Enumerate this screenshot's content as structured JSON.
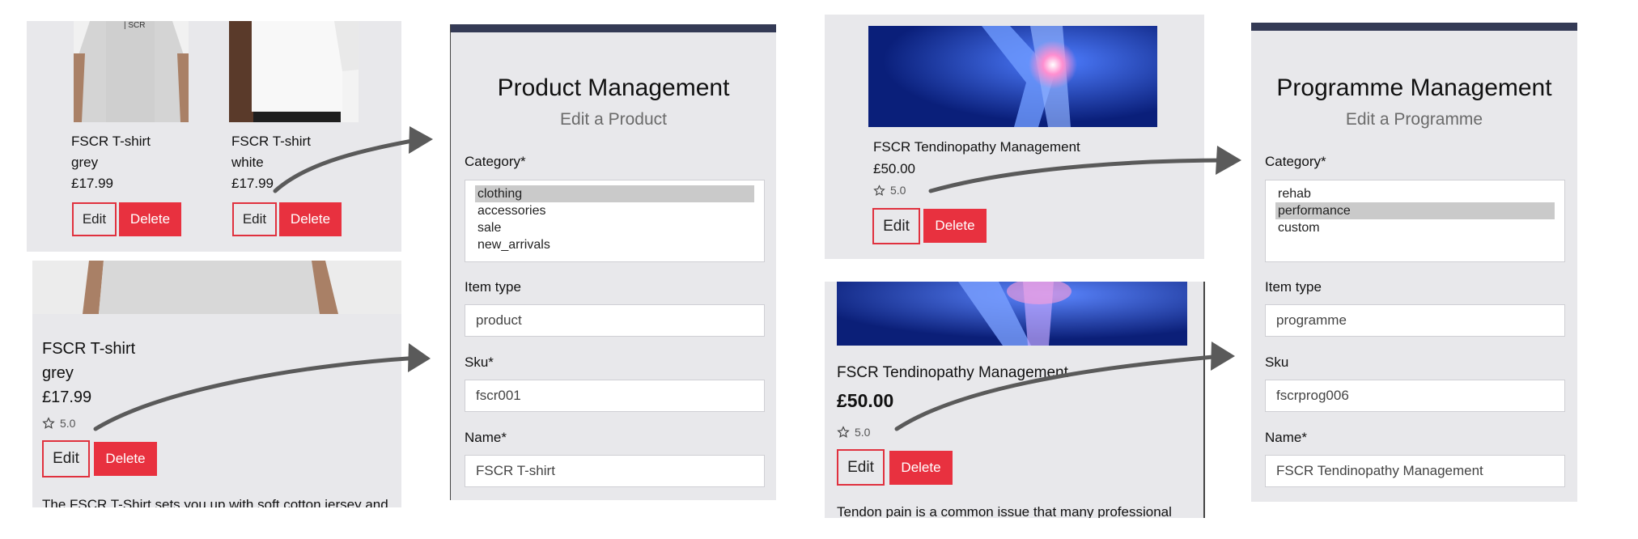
{
  "product_cards": [
    {
      "name": "FSCR T-shirt",
      "color": "grey",
      "price": "£17.99",
      "edit": "Edit",
      "delete": "Delete"
    },
    {
      "name": "FSCR T-shirt",
      "color": "white",
      "price": "£17.99",
      "edit": "Edit",
      "delete": "Delete"
    }
  ],
  "product_detail": {
    "name": "FSCR T-shirt",
    "color": "grey",
    "price": "£17.99",
    "rating": "5.0",
    "edit": "Edit",
    "delete": "Delete",
    "description": "The FSCR T-Shirt sets you up with soft cotton jersey and"
  },
  "product_form": {
    "title": "Product Management",
    "subtitle": "Edit a Product",
    "category_label": "Category*",
    "category_options": [
      "clothing",
      "accessories",
      "sale",
      "new_arrivals"
    ],
    "category_selected": "clothing",
    "item_type_label": "Item type",
    "item_type_value": "product",
    "sku_label": "Sku*",
    "sku_value": "fscr001",
    "name_label": "Name*",
    "name_value": "FSCR T-shirt"
  },
  "programme_card": {
    "name": "FSCR Tendinopathy Management",
    "price": "£50.00",
    "rating": "5.0",
    "edit": "Edit",
    "delete": "Delete"
  },
  "programme_detail": {
    "name": "FSCR Tendinopathy Management",
    "price": "£50.00",
    "rating": "5.0",
    "edit": "Edit",
    "delete": "Delete",
    "description": "Tendon pain is a common issue that many professional"
  },
  "programme_form": {
    "title": "Programme Management",
    "subtitle": "Edit a Programme",
    "category_label": "Category*",
    "category_options": [
      "rehab",
      "performance",
      "custom"
    ],
    "category_selected": "performance",
    "item_type_label": "Item type",
    "item_type_value": "programme",
    "sku_label": "Sku",
    "sku_value": "fscrprog006",
    "name_label": "Name*",
    "name_value": "FSCR Tendinopathy Management"
  },
  "colors": {
    "delete": "#e8313f",
    "edit_border": "#e0313e",
    "topbar": "#343a55",
    "panel": "#e8e8eb"
  },
  "icons": {
    "rating": "star-outline-icon",
    "annotation": "arrow-right-icon"
  }
}
